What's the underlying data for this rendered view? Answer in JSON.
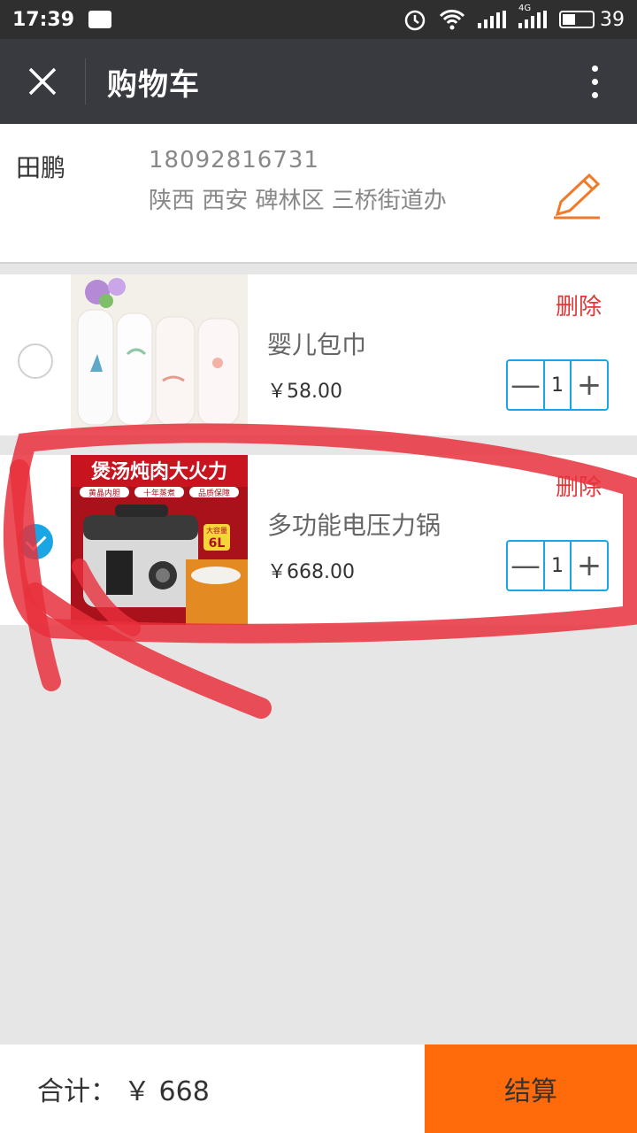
{
  "status_bar": {
    "time": "17:39",
    "network": "4G",
    "battery": "39",
    "icons": [
      "image-icon",
      "alarm-icon",
      "wifi-icon",
      "signal-icon",
      "battery-icon"
    ]
  },
  "nav": {
    "title": "购物车",
    "close_icon": "close-icon",
    "more_icon": "more-vertical-icon"
  },
  "address": {
    "name": "田鹏",
    "phone": "18092816731",
    "detail": "陕西 西安 碑林区 三桥街道办",
    "edit_icon": "pencil-icon"
  },
  "items": [
    {
      "name": "婴儿包巾",
      "price": "￥58.00",
      "quantity": "1",
      "delete_label": "删除",
      "checked": false,
      "thumb": "swaddle-blankets-image"
    },
    {
      "name": "多功能电压力锅",
      "price": "￥668.00",
      "quantity": "1",
      "delete_label": "删除",
      "checked": true,
      "thumb": "pressure-cooker-image",
      "thumb_text": {
        "banner": "煲汤炖肉大火力",
        "badges": [
          "黄晶内胆",
          "十年蒸煮",
          "品质保障"
        ],
        "size_top": "大容量",
        "size": "6L"
      }
    }
  ],
  "footer": {
    "total_label": "合计：",
    "total_value": "￥ 668",
    "checkout_label": "结算"
  },
  "colors": {
    "accent_orange": "#ff6a0a",
    "accent_blue": "#1aa6e4",
    "delete_red": "#e03838",
    "nav_bg": "#393a3f",
    "annotation_red": "#e8303c"
  }
}
